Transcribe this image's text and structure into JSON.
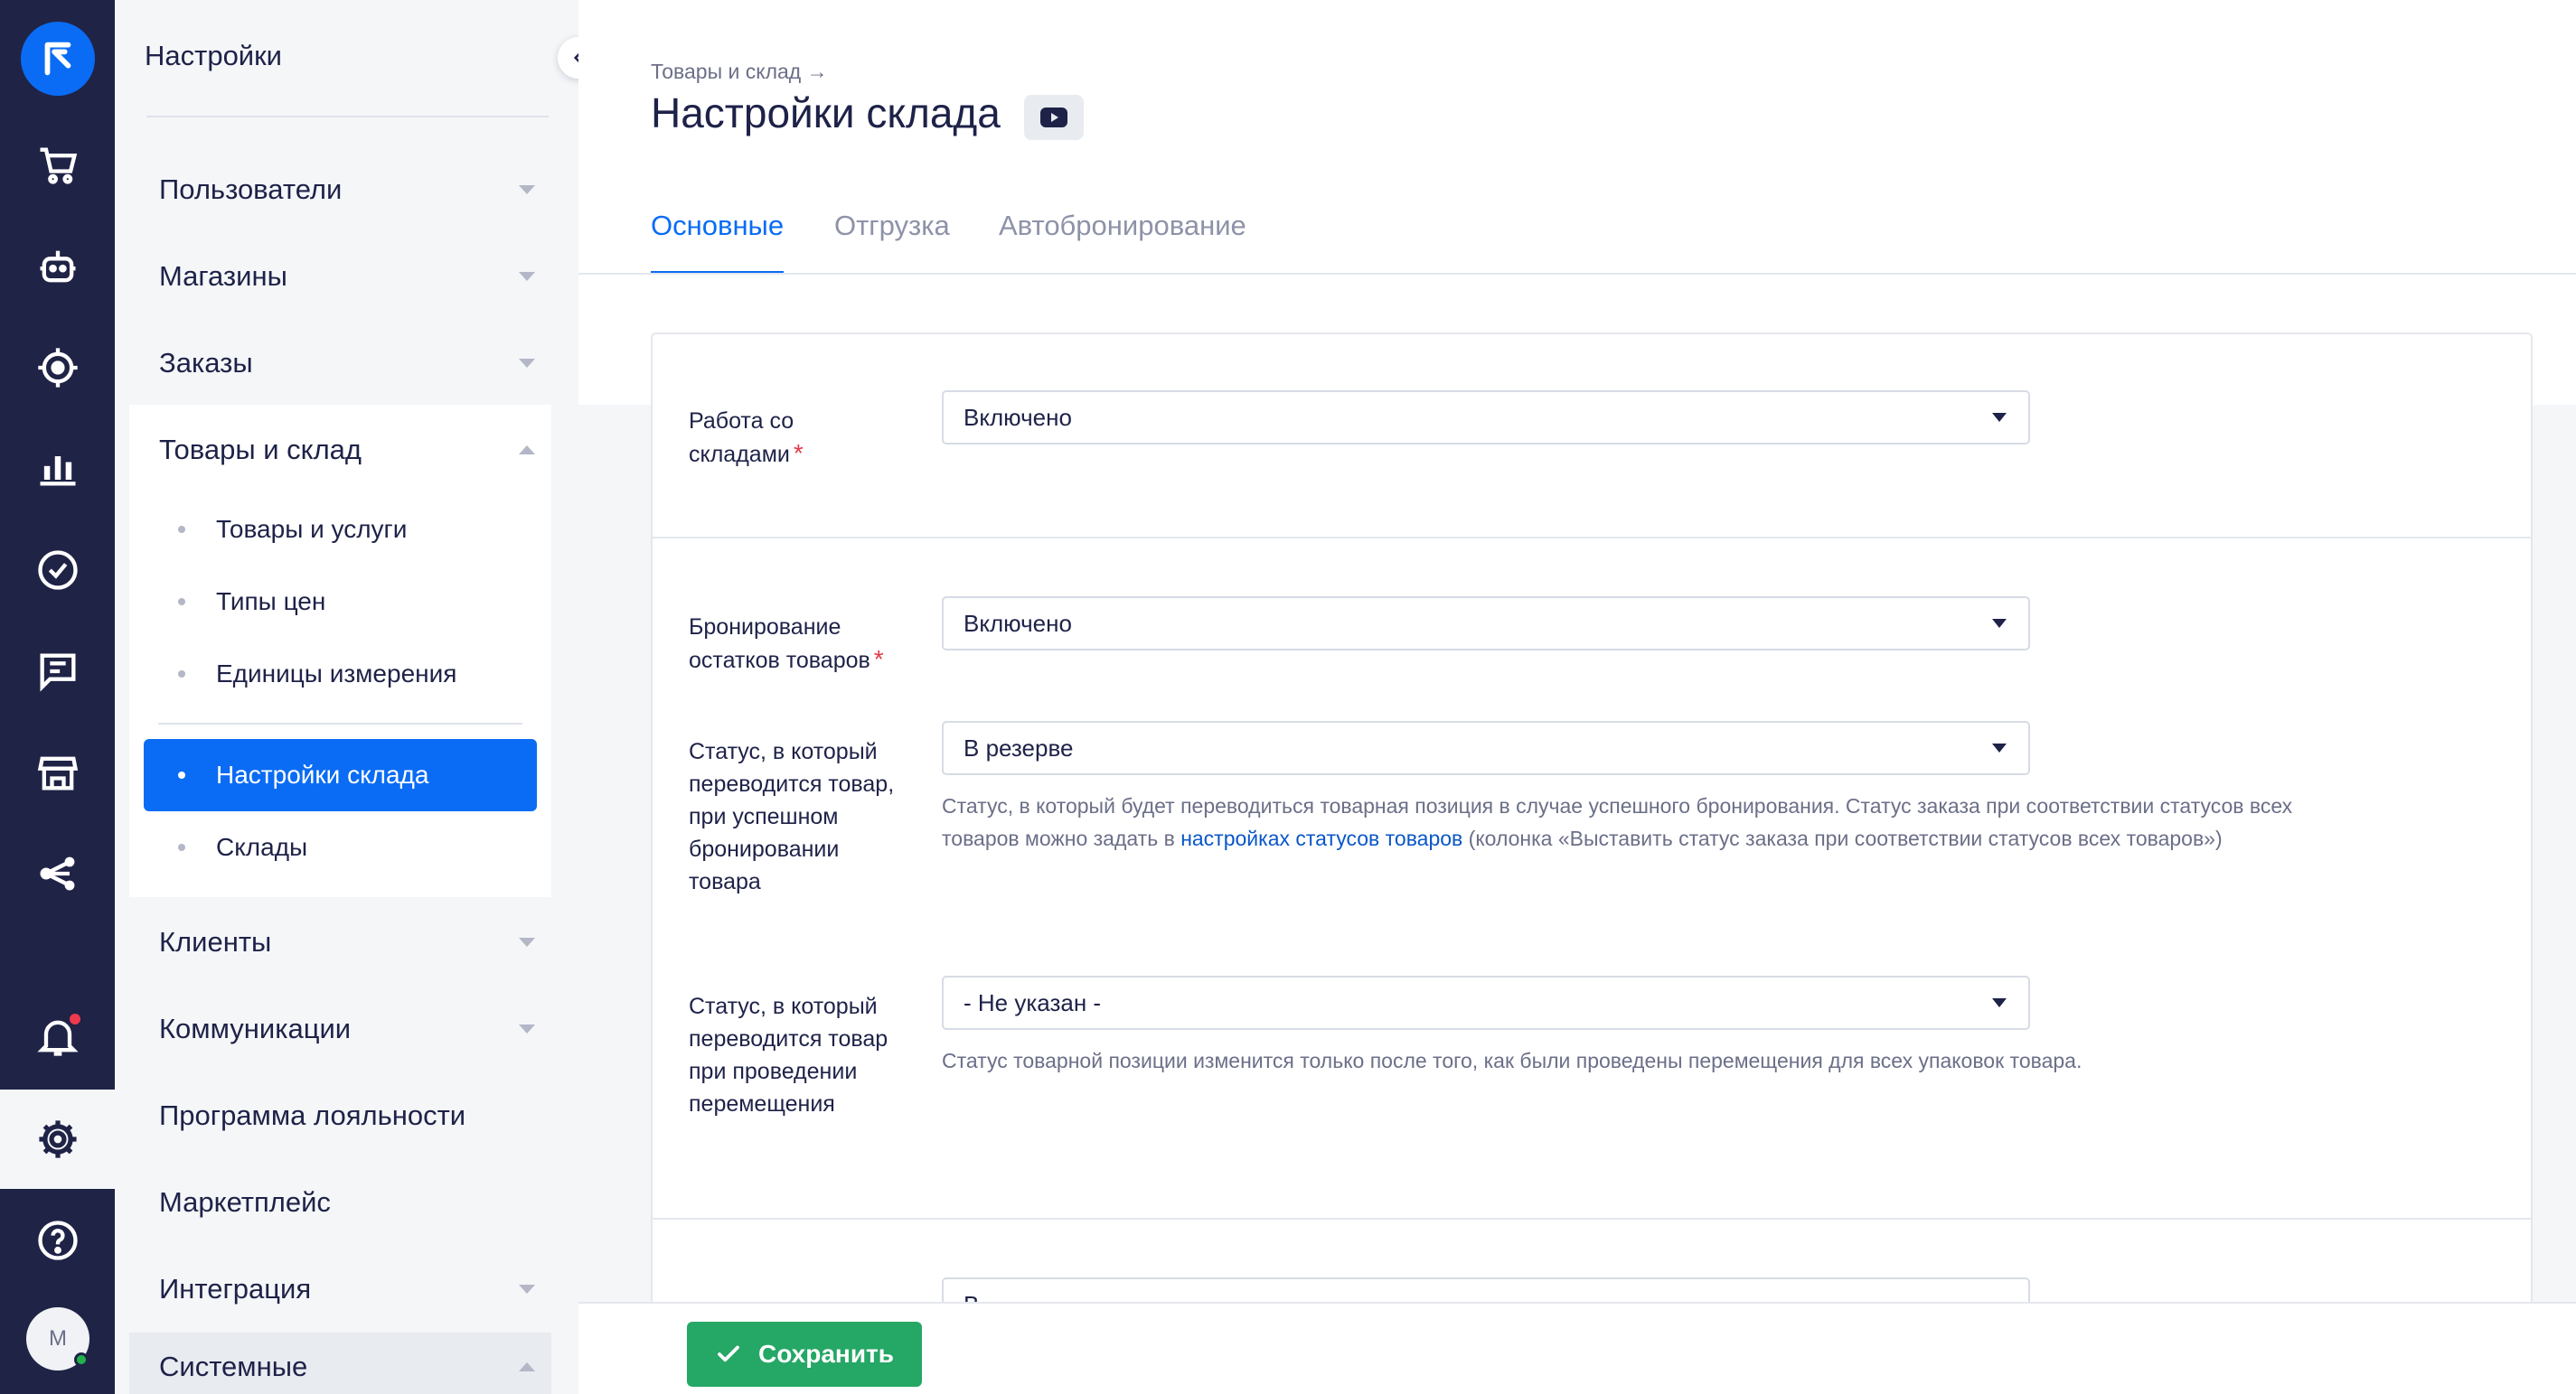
{
  "colors": {
    "accent": "#0a6cf4",
    "rail": "#1f2346",
    "save": "#25a765",
    "required": "#e23a4a"
  },
  "rail": {
    "icons": [
      "logo-icon",
      "cart-icon",
      "bot-icon",
      "target-icon",
      "analytics-icon",
      "tasks-icon",
      "chat-icon",
      "store-icon",
      "integrations-icon",
      "bell-icon",
      "settings-icon",
      "help-icon"
    ],
    "avatar_initial": "M"
  },
  "menu": {
    "title": "Настройки",
    "items": [
      {
        "label": "Пользователи"
      },
      {
        "label": "Магазины"
      },
      {
        "label": "Заказы"
      },
      {
        "label": "Товары и склад"
      },
      {
        "label": "Клиенты"
      },
      {
        "label": "Коммуникации"
      },
      {
        "label": "Программа лояльности"
      },
      {
        "label": "Маркетплейс"
      },
      {
        "label": "Интеграция"
      },
      {
        "label": "Системные"
      }
    ],
    "goods_sub": [
      {
        "label": "Товары и услуги"
      },
      {
        "label": "Типы цен"
      },
      {
        "label": "Единицы измерения"
      },
      {
        "label": "Настройки склада"
      },
      {
        "label": "Склады"
      }
    ]
  },
  "header": {
    "breadcrumb": "Товары и склад →",
    "title": "Настройки склада",
    "tabs": [
      {
        "label": "Основные"
      },
      {
        "label": "Отгрузка"
      },
      {
        "label": "Автобронирование"
      }
    ]
  },
  "form": {
    "warehouses": {
      "label": "Работа со складами",
      "value": "Включено"
    },
    "reservation": {
      "label": "Бронирование остатков товаров",
      "value": "Включено"
    },
    "reserve_status": {
      "label": "Статус, в который переводится товар, при успешном бронировании товара",
      "value": "В резерве",
      "hint_before": "Статус, в который будет переводиться товарная позиция в случае успешного бронирования. Статус заказа при соответствии статусов всех товаров можно задать в",
      "hint_link": "настройках статусов товаров",
      "hint_after": "(колонка «Выставить статус заказа при соответствии статусов всех товаров»)"
    },
    "move_status": {
      "label": "Статус, в который переводится товар при проведении перемещения",
      "value": "- Не указан -",
      "hint": "Статус товарной позиции изменится только после того, как были проведены перемещения для всех упаковок товара."
    },
    "next_value": "В"
  },
  "footer": {
    "save_label": "Сохранить"
  }
}
